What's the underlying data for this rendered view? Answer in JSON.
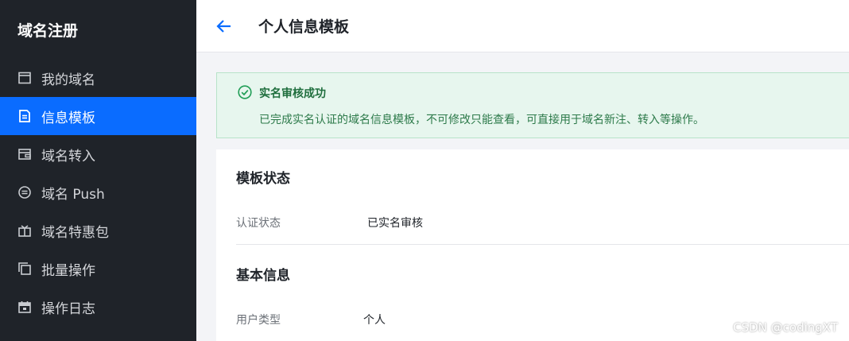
{
  "sidebar": {
    "brand": "域名注册",
    "items": [
      {
        "label": "我的域名",
        "icon": "calendar-box-icon"
      },
      {
        "label": "信息模板",
        "icon": "document-icon",
        "active": true
      },
      {
        "label": "域名转入",
        "icon": "wallet-icon"
      },
      {
        "label": "域名 Push",
        "icon": "circle-minus-icon"
      },
      {
        "label": "域名特惠包",
        "icon": "gift-icon"
      },
      {
        "label": "批量操作",
        "icon": "copy-icon"
      },
      {
        "label": "操作日志",
        "icon": "calendar-icon"
      }
    ],
    "active_color": "#0a6cff"
  },
  "header": {
    "title": "个人信息模板",
    "back_icon": "arrow-left-icon"
  },
  "alert": {
    "title": "实名审核成功",
    "description": "已完成实名认证的域名信息模板，不可修改只能查看，可直接用于域名新注、转入等操作。",
    "icon": "check-circle-icon",
    "color": "#1f9d55"
  },
  "sections": {
    "status": {
      "title": "模板状态",
      "fields": [
        {
          "label": "认证状态",
          "value": "已实名审核"
        }
      ]
    },
    "basic": {
      "title": "基本信息",
      "fields": [
        {
          "label": "用户类型",
          "value": "个人"
        }
      ]
    }
  },
  "watermark": "CSDN @codingXT"
}
